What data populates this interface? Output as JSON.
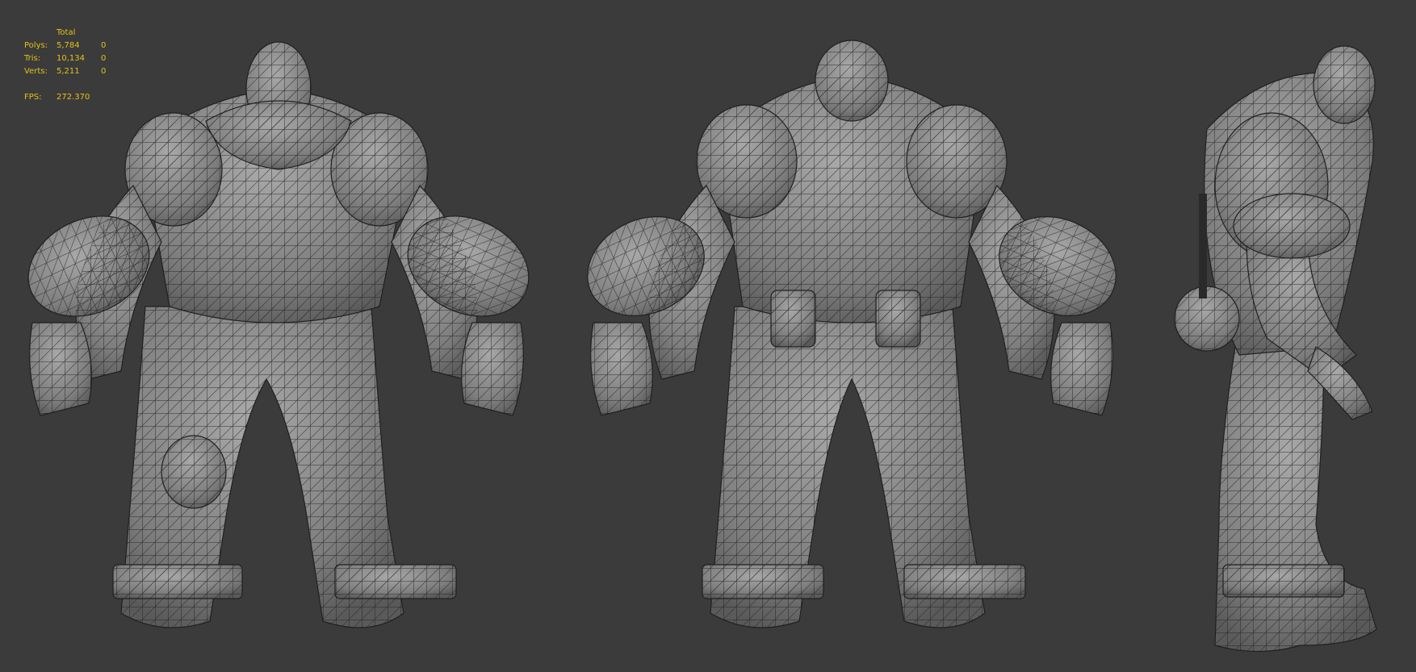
{
  "stats": {
    "header_total": "Total",
    "rows": [
      {
        "label": "Polys:",
        "total": "5,784",
        "selected": "0"
      },
      {
        "label": "Tris:",
        "total": "10,134",
        "selected": "0"
      },
      {
        "label": "Verts:",
        "total": "5,211",
        "selected": "0"
      }
    ],
    "fps_label": "FPS:",
    "fps_value": "272.370"
  },
  "colors": {
    "viewport_bg": "#3b3b3b",
    "stats_text": "#e2c21a",
    "model_fill": "#8e8e8e",
    "wire": "#1c1c1c"
  },
  "views": [
    "front",
    "back",
    "side"
  ]
}
